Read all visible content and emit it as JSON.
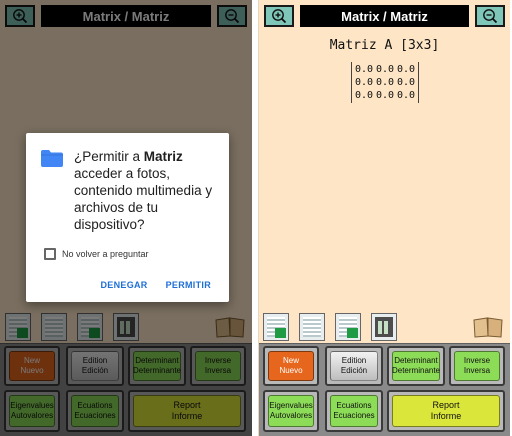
{
  "app": {
    "title": "Matrix / Matriz",
    "zoom_in_icon": "zoom-in-icon",
    "zoom_out_icon": "zoom-out-icon",
    "matrix_heading": "Matriz A [3x3]",
    "matrix_rows": [
      [
        "0.0",
        "0.0",
        "0.0"
      ],
      [
        "0.0",
        "0.0",
        "0.0"
      ],
      [
        "0.0",
        "0.0",
        "0.0"
      ]
    ],
    "buttons": {
      "new": [
        "New",
        "Nuevo"
      ],
      "edit": [
        "Edition",
        "Edición"
      ],
      "determinant": [
        "Determinant",
        "Determinante"
      ],
      "inverse": [
        "Inverse",
        "Inversa"
      ],
      "eigenvalues": [
        "Eigenvalues",
        "Autovalores"
      ],
      "equations": [
        "Ecuations",
        "Ecuaciones"
      ],
      "report": [
        "Report",
        "Informe"
      ]
    },
    "colors": {
      "background": "#fde5c6",
      "title_bar": "#000000",
      "zoom_button": "#7fc7b9",
      "new_button": "#e5661c",
      "action_button": "#8ddc58",
      "report_button": "#dbe63a"
    }
  },
  "permission_dialog": {
    "question_prefix": "¿Permitir a ",
    "app_name": "Matriz",
    "question_suffix": " acceder a fotos, contenido multimedia y archivos de tu dispositivo?",
    "checkbox_label": "No volver a preguntar",
    "deny_label": "DENEGAR",
    "allow_label": "PERMITIR",
    "icon": "folder-icon",
    "accent_color": "#1e6fd6"
  }
}
